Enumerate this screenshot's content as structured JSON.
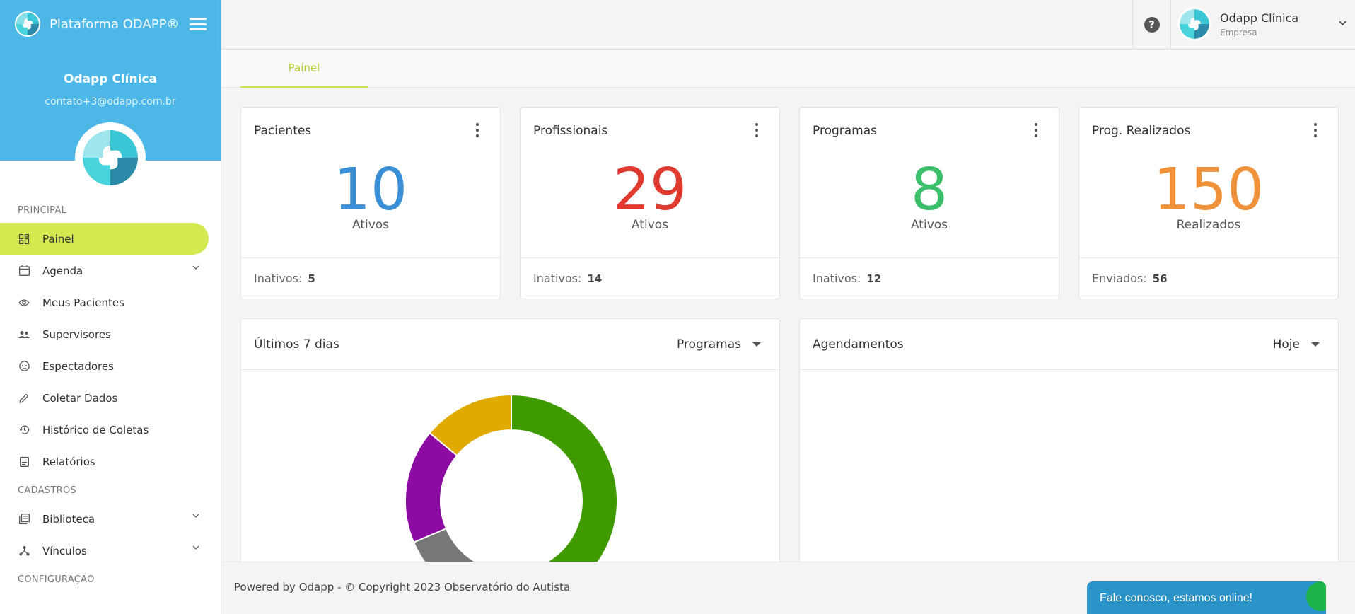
{
  "app": {
    "brand": "Plataforma ODAPP®",
    "user_name": "Odapp Clínica",
    "user_email": "contato+3@odapp.com.br"
  },
  "sidebar": {
    "sections": [
      {
        "title": "PRINCIPAL",
        "items": [
          {
            "label": "Painel",
            "icon": "dashboard-icon",
            "active": true,
            "expandable": false
          },
          {
            "label": "Agenda",
            "icon": "calendar-icon",
            "active": false,
            "expandable": true
          },
          {
            "label": "Meus Pacientes",
            "icon": "eye-icon",
            "active": false,
            "expandable": false
          },
          {
            "label": "Supervisores",
            "icon": "people-icon",
            "active": false,
            "expandable": false
          },
          {
            "label": "Espectadores",
            "icon": "face-icon",
            "active": false,
            "expandable": false
          },
          {
            "label": "Coletar Dados",
            "icon": "pencil-icon",
            "active": false,
            "expandable": false
          },
          {
            "label": "Histórico de Coletas",
            "icon": "history-icon",
            "active": false,
            "expandable": false
          },
          {
            "label": "Relatórios",
            "icon": "clipboard-icon",
            "active": false,
            "expandable": false
          }
        ]
      },
      {
        "title": "CADASTROS",
        "items": [
          {
            "label": "Biblioteca",
            "icon": "library-icon",
            "active": false,
            "expandable": true
          },
          {
            "label": "Vínculos",
            "icon": "link-icon",
            "active": false,
            "expandable": true
          }
        ]
      },
      {
        "title": "CONFIGURAÇÃO",
        "items": []
      }
    ]
  },
  "header": {
    "help_symbol": "?",
    "profile_name": "Odapp Clínica",
    "profile_role": "Empresa"
  },
  "tabs": [
    {
      "label": "Painel",
      "active": true
    }
  ],
  "stats": [
    {
      "title": "Pacientes",
      "value": "10",
      "label": "Ativos",
      "foot_label": "Inativos:",
      "foot_value": "5",
      "color": "#3a8fd6"
    },
    {
      "title": "Profissionais",
      "value": "29",
      "label": "Ativos",
      "foot_label": "Inativos:",
      "foot_value": "14",
      "color": "#e03a2f"
    },
    {
      "title": "Programas",
      "value": "8",
      "label": "Ativos",
      "foot_label": "Inativos:",
      "foot_value": "12",
      "color": "#3cbf6a"
    },
    {
      "title": "Prog. Realizados",
      "value": "150",
      "label": "Realizados",
      "foot_label": "Enviados:",
      "foot_value": "56",
      "color": "#f0923a"
    }
  ],
  "panels": {
    "chart": {
      "title": "Últimos 7 dias",
      "select": "Programas"
    },
    "schedule": {
      "title": "Agendamentos",
      "select": "Hoje"
    }
  },
  "chart_data": {
    "type": "pie",
    "donut": true,
    "title": "",
    "slices": [
      {
        "value": 43,
        "color": "#3f9a00"
      },
      {
        "value": 16,
        "color": "#777777"
      },
      {
        "value": 15,
        "color": "#8b0ba3"
      },
      {
        "value": 12,
        "color": "#e0aa00"
      }
    ]
  },
  "footer": {
    "text": "Powered by Odapp - © Copyright 2023 Observatório do Autista",
    "chat": "Fale conosco, estamos online!"
  }
}
